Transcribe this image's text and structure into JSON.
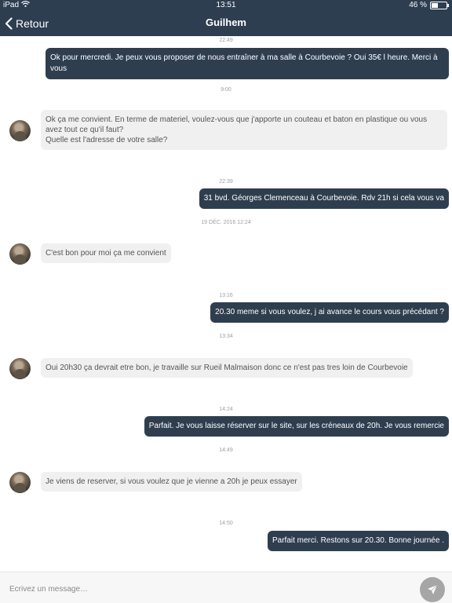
{
  "status_bar": {
    "device": "iPad",
    "time": "13:51",
    "battery": "46 %",
    "battery_level": 0.46
  },
  "header": {
    "back_label": "Retour",
    "title": "Guilhem"
  },
  "messages": [
    {
      "time": "22:49"
    },
    {
      "text": "Ok pour mercredi. Je peux vous proposer de nous entraîner à ma salle à Courbevoie ? Oui 35€ l heure. Merci à vous"
    },
    {
      "time": "9:00"
    },
    {
      "text": "Ok ça me convient. En terme de materiel, voulez-vous que j'apporte un couteau et baton en plastique ou vous avez tout ce qu'il faut?\nQuelle est l'adresse de votre salle?"
    },
    {
      "time": "22:39"
    },
    {
      "text": "31 bvd. Géorges Clemenceau à Courbevoie. Rdv 21h si cela vous va"
    },
    {
      "time": "19 DÉC. 2016 12:24"
    },
    {
      "text": "C'est bon pour moi ça me convient"
    },
    {
      "time": "13:16"
    },
    {
      "text": "20.30 meme si vous voulez, j ai avance le cours vous précédant ?"
    },
    {
      "time": "13:34"
    },
    {
      "text": "Oui 20h30 ça devrait etre bon, je travaille sur Rueil Malmaison donc ce n'est pas tres loin de Courbevoie"
    },
    {
      "time": "14:24"
    },
    {
      "text": "Parfait. Je vous laisse réserver sur le site, sur les créneaux de 20h. Je vous remercie"
    },
    {
      "time": "14:49"
    },
    {
      "text": "Je viens de reserver, si vous voulez que je vienne a 20h je peux essayer"
    },
    {
      "time": "14:50"
    },
    {
      "text": "Parfait merci. Restons sur 20.30. Bonne journée ."
    }
  ],
  "composer": {
    "placeholder": "Ecrivez un message…"
  },
  "icons": {
    "back": "chevron-left-icon",
    "wifi": "wifi-icon",
    "send": "send-icon",
    "battery": "battery-icon"
  },
  "colors": {
    "header_bg": "#2c3e50",
    "outgoing_bubble": "#2f3e4f",
    "incoming_bubble": "#f0f0f0",
    "send_button": "#a6a6a6"
  }
}
